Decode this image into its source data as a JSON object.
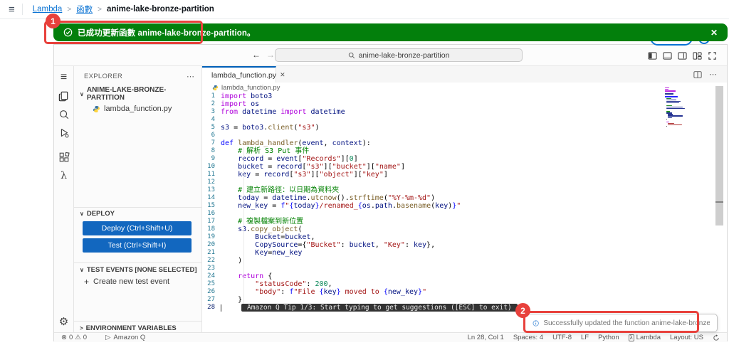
{
  "colors": {
    "success_green": "#037f0c",
    "annotation_red": "#e8413c",
    "link_blue": "#0972d3",
    "button_blue": "#1267bf",
    "tab_accent": "#005fb8"
  },
  "aws_header": {
    "breadcrumb": [
      "Lambda",
      "函數",
      "anime-lake-bronze-partition"
    ],
    "separator": ">"
  },
  "banner": {
    "message": "已成功更新函數 anime-lake-bronze-partition。",
    "close": "✕"
  },
  "annotations": {
    "badge_1": "1",
    "badge_2": "2"
  },
  "toast": {
    "message": "Successfully updated the function anime-lake-bronze-partition."
  },
  "nav": {
    "back": "←",
    "forward": "→",
    "search_value": "anime-lake-bronze-partition"
  },
  "explorer": {
    "title": "EXPLORER",
    "more": "⋯",
    "folder_chevron": "∨",
    "folder": "ANIME-LAKE-BRONZE-PARTITION",
    "file": "lambda_function.py"
  },
  "deploy": {
    "chevron": "∨",
    "title": "DEPLOY",
    "deploy_button": "Deploy (Ctrl+Shift+U)",
    "test_button": "Test (Ctrl+Shift+I)"
  },
  "test_events": {
    "chevron": "∨",
    "title": "TEST EVENTS [NONE SELECTED]",
    "plus": "+",
    "create": "Create new test event"
  },
  "environment": {
    "chevron": ">",
    "title": "ENVIRONMENT VARIABLES"
  },
  "tab": {
    "title": "lambda_function.py",
    "close": "✕"
  },
  "editor_breadcrumb": "lambda_function.py",
  "editor": {
    "active_line": 28,
    "q_tip": "Amazon Q Tip 1/3: Start typing to get suggestions ([ESC] to exit)",
    "token_colors": {
      "k": "#af00db",
      "b": "#0000ff",
      "f": "#795e26",
      "v": "#001080",
      "s": "#a31515",
      "c": "#008000",
      "n": "#098658",
      "p": "#000000"
    },
    "lines": [
      {
        "n": 1,
        "t": [
          [
            "k",
            "import "
          ],
          [
            "v",
            "boto3"
          ]
        ]
      },
      {
        "n": 2,
        "t": [
          [
            "k",
            "import "
          ],
          [
            "v",
            "os"
          ]
        ]
      },
      {
        "n": 3,
        "t": [
          [
            "k",
            "from "
          ],
          [
            "v",
            "datetime "
          ],
          [
            "k",
            "import "
          ],
          [
            "v",
            "datetime"
          ]
        ]
      },
      {
        "n": 4,
        "t": []
      },
      {
        "n": 5,
        "t": [
          [
            "v",
            "s3 "
          ],
          [
            "p",
            "= "
          ],
          [
            "v",
            "boto3"
          ],
          [
            "p",
            "."
          ],
          [
            "f",
            "client"
          ],
          [
            "p",
            "("
          ],
          [
            "s",
            "\"s3\""
          ],
          [
            "p",
            ")"
          ]
        ]
      },
      {
        "n": 6,
        "t": []
      },
      {
        "n": 7,
        "t": [
          [
            "b",
            "def "
          ],
          [
            "f",
            "lambda_handler"
          ],
          [
            "p",
            "("
          ],
          [
            "v",
            "event"
          ],
          [
            "p",
            ", "
          ],
          [
            "v",
            "context"
          ],
          [
            "p",
            "):"
          ]
        ]
      },
      {
        "n": 8,
        "t": [
          [
            "c",
            "    # 解析 S3 Put 事件"
          ]
        ]
      },
      {
        "n": 9,
        "t": [
          [
            "p",
            "    "
          ],
          [
            "v",
            "record "
          ],
          [
            "p",
            "= "
          ],
          [
            "v",
            "event"
          ],
          [
            "p",
            "["
          ],
          [
            "s",
            "\"Records\""
          ],
          [
            "p",
            "]["
          ],
          [
            "n",
            "0"
          ],
          [
            "p",
            "]"
          ]
        ]
      },
      {
        "n": 10,
        "t": [
          [
            "p",
            "    "
          ],
          [
            "v",
            "bucket "
          ],
          [
            "p",
            "= "
          ],
          [
            "v",
            "record"
          ],
          [
            "p",
            "["
          ],
          [
            "s",
            "\"s3\""
          ],
          [
            "p",
            "]["
          ],
          [
            "s",
            "\"bucket\""
          ],
          [
            "p",
            "]["
          ],
          [
            "s",
            "\"name\""
          ],
          [
            "p",
            "]"
          ]
        ]
      },
      {
        "n": 11,
        "t": [
          [
            "p",
            "    "
          ],
          [
            "v",
            "key "
          ],
          [
            "p",
            "= "
          ],
          [
            "v",
            "record"
          ],
          [
            "p",
            "["
          ],
          [
            "s",
            "\"s3\""
          ],
          [
            "p",
            "]["
          ],
          [
            "s",
            "\"object\""
          ],
          [
            "p",
            "]["
          ],
          [
            "s",
            "\"key\""
          ],
          [
            "p",
            "]"
          ]
        ]
      },
      {
        "n": 12,
        "t": []
      },
      {
        "n": 13,
        "t": [
          [
            "c",
            "    # 建立新路徑：以日期為資料夾"
          ]
        ]
      },
      {
        "n": 14,
        "t": [
          [
            "p",
            "    "
          ],
          [
            "v",
            "today "
          ],
          [
            "p",
            "= "
          ],
          [
            "v",
            "datetime"
          ],
          [
            "p",
            "."
          ],
          [
            "f",
            "utcnow"
          ],
          [
            "p",
            "()."
          ],
          [
            "f",
            "strftime"
          ],
          [
            "p",
            "("
          ],
          [
            "s",
            "\"%Y-%m-%d\""
          ],
          [
            "p",
            ")"
          ]
        ]
      },
      {
        "n": 15,
        "t": [
          [
            "p",
            "    "
          ],
          [
            "v",
            "new_key "
          ],
          [
            "p",
            "= "
          ],
          [
            "b",
            "f"
          ],
          [
            "s",
            "\""
          ],
          [
            "b",
            "{"
          ],
          [
            "v",
            "today"
          ],
          [
            "b",
            "}"
          ],
          [
            "s",
            "/renamed_"
          ],
          [
            "b",
            "{"
          ],
          [
            "v",
            "os"
          ],
          [
            "p",
            "."
          ],
          [
            "v",
            "path"
          ],
          [
            "p",
            "."
          ],
          [
            "f",
            "basename"
          ],
          [
            "p",
            "("
          ],
          [
            "v",
            "key"
          ],
          [
            "p",
            ")"
          ],
          [
            "b",
            "}"
          ],
          [
            "s",
            "\""
          ]
        ]
      },
      {
        "n": 16,
        "t": []
      },
      {
        "n": 17,
        "t": [
          [
            "c",
            "    # 複製檔案到新位置"
          ]
        ]
      },
      {
        "n": 18,
        "t": [
          [
            "p",
            "    "
          ],
          [
            "v",
            "s3"
          ],
          [
            "p",
            "."
          ],
          [
            "f",
            "copy_object"
          ],
          [
            "p",
            "("
          ]
        ]
      },
      {
        "n": 19,
        "t": [
          [
            "p",
            "        "
          ],
          [
            "v",
            "Bucket"
          ],
          [
            "p",
            "="
          ],
          [
            "v",
            "bucket"
          ],
          [
            "p",
            ","
          ]
        ]
      },
      {
        "n": 20,
        "t": [
          [
            "p",
            "        "
          ],
          [
            "v",
            "CopySource"
          ],
          [
            "p",
            "={"
          ],
          [
            "s",
            "\"Bucket\""
          ],
          [
            "p",
            ": "
          ],
          [
            "v",
            "bucket"
          ],
          [
            "p",
            ", "
          ],
          [
            "s",
            "\"Key\""
          ],
          [
            "p",
            ": "
          ],
          [
            "v",
            "key"
          ],
          [
            "p",
            "},"
          ]
        ]
      },
      {
        "n": 21,
        "t": [
          [
            "p",
            "        "
          ],
          [
            "v",
            "Key"
          ],
          [
            "p",
            "="
          ],
          [
            "v",
            "new_key"
          ]
        ]
      },
      {
        "n": 22,
        "t": [
          [
            "p",
            "    )"
          ]
        ]
      },
      {
        "n": 23,
        "t": []
      },
      {
        "n": 24,
        "t": [
          [
            "k",
            "    return "
          ],
          [
            "p",
            "{"
          ]
        ]
      },
      {
        "n": 25,
        "t": [
          [
            "p",
            "        "
          ],
          [
            "s",
            "\"statusCode\""
          ],
          [
            "p",
            ": "
          ],
          [
            "n",
            "200"
          ],
          [
            "p",
            ","
          ]
        ]
      },
      {
        "n": 26,
        "t": [
          [
            "p",
            "        "
          ],
          [
            "s",
            "\"body\""
          ],
          [
            "p",
            ": "
          ],
          [
            "b",
            "f"
          ],
          [
            "s",
            "\"File "
          ],
          [
            "b",
            "{"
          ],
          [
            "v",
            "key"
          ],
          [
            "b",
            "}"
          ],
          [
            "s",
            " moved to "
          ],
          [
            "b",
            "{"
          ],
          [
            "v",
            "new_key"
          ],
          [
            "b",
            "}"
          ],
          [
            "s",
            "\""
          ]
        ]
      },
      {
        "n": 27,
        "t": [
          [
            "p",
            "    }"
          ]
        ]
      },
      {
        "n": 28,
        "t": []
      }
    ]
  },
  "status_bar": {
    "errors": "0",
    "warnings": "0",
    "amazon_q": "Amazon Q",
    "right": [
      {
        "label": "Ln 28, Col 1"
      },
      {
        "label": "Spaces: 4"
      },
      {
        "label": "UTF-8"
      },
      {
        "label": "LF"
      },
      {
        "label": "Python"
      },
      {
        "label": "Lambda",
        "icon": "lambda"
      },
      {
        "label": "Layout: US"
      }
    ]
  }
}
